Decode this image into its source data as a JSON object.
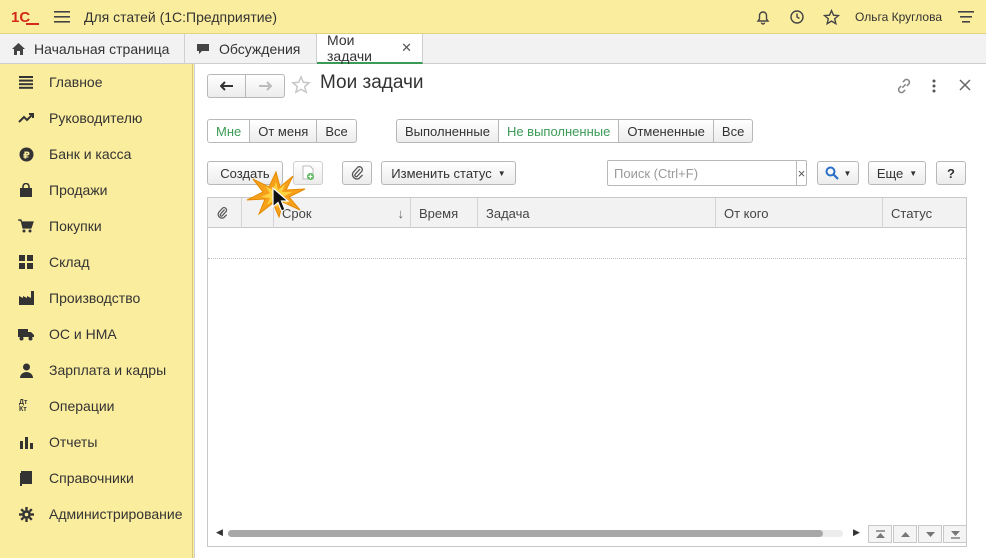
{
  "app": {
    "logo_text": "1С",
    "title": "Для статей  (1С:Предприятие)",
    "user": "Ольга Круглова"
  },
  "tabs": [
    {
      "label": "Начальная страница",
      "icon": "home-icon"
    },
    {
      "label": "Обсуждения",
      "icon": "chat-icon"
    },
    {
      "label": "Мои задачи",
      "icon": "",
      "active": true
    }
  ],
  "sidebar": {
    "items": [
      {
        "label": "Главное",
        "icon": "list-icon"
      },
      {
        "label": "Руководителю",
        "icon": "trend-icon"
      },
      {
        "label": "Банк и касса",
        "icon": "ruble-icon"
      },
      {
        "label": "Продажи",
        "icon": "bag-icon"
      },
      {
        "label": "Покупки",
        "icon": "cart-icon"
      },
      {
        "label": "Склад",
        "icon": "warehouse-icon"
      },
      {
        "label": "Производство",
        "icon": "factory-icon"
      },
      {
        "label": "ОС и НМА",
        "icon": "truck-icon"
      },
      {
        "label": "Зарплата и кадры",
        "icon": "person-icon"
      },
      {
        "label": "Операции",
        "icon": "dt-kt-icon"
      },
      {
        "label": "Отчеты",
        "icon": "bar-chart-icon"
      },
      {
        "label": "Справочники",
        "icon": "book-icon"
      },
      {
        "label": "Администрирование",
        "icon": "gear-icon"
      }
    ]
  },
  "form": {
    "title": "Мои задачи",
    "filter_who": [
      "Мне",
      "От меня",
      "Все"
    ],
    "filter_state": [
      "Выполненные",
      "Не выполненные",
      "Отмененные",
      "Все"
    ],
    "create_label": "Создать",
    "change_status_label": "Изменить статус",
    "search_placeholder": "Поиск (Ctrl+F)",
    "search_clear": "×",
    "more_label": "Еще",
    "help_label": "?",
    "dt_kt": "Дт Кт"
  },
  "table": {
    "columns": [
      "Срок",
      "Время",
      "Задача",
      "От кого",
      "Статус"
    ],
    "sort_indicator": "↓"
  },
  "colors": {
    "sidebar_bg": "#fbed9e",
    "accent_green": "#3b9a56",
    "cursor_burst": "#f7a11a"
  }
}
